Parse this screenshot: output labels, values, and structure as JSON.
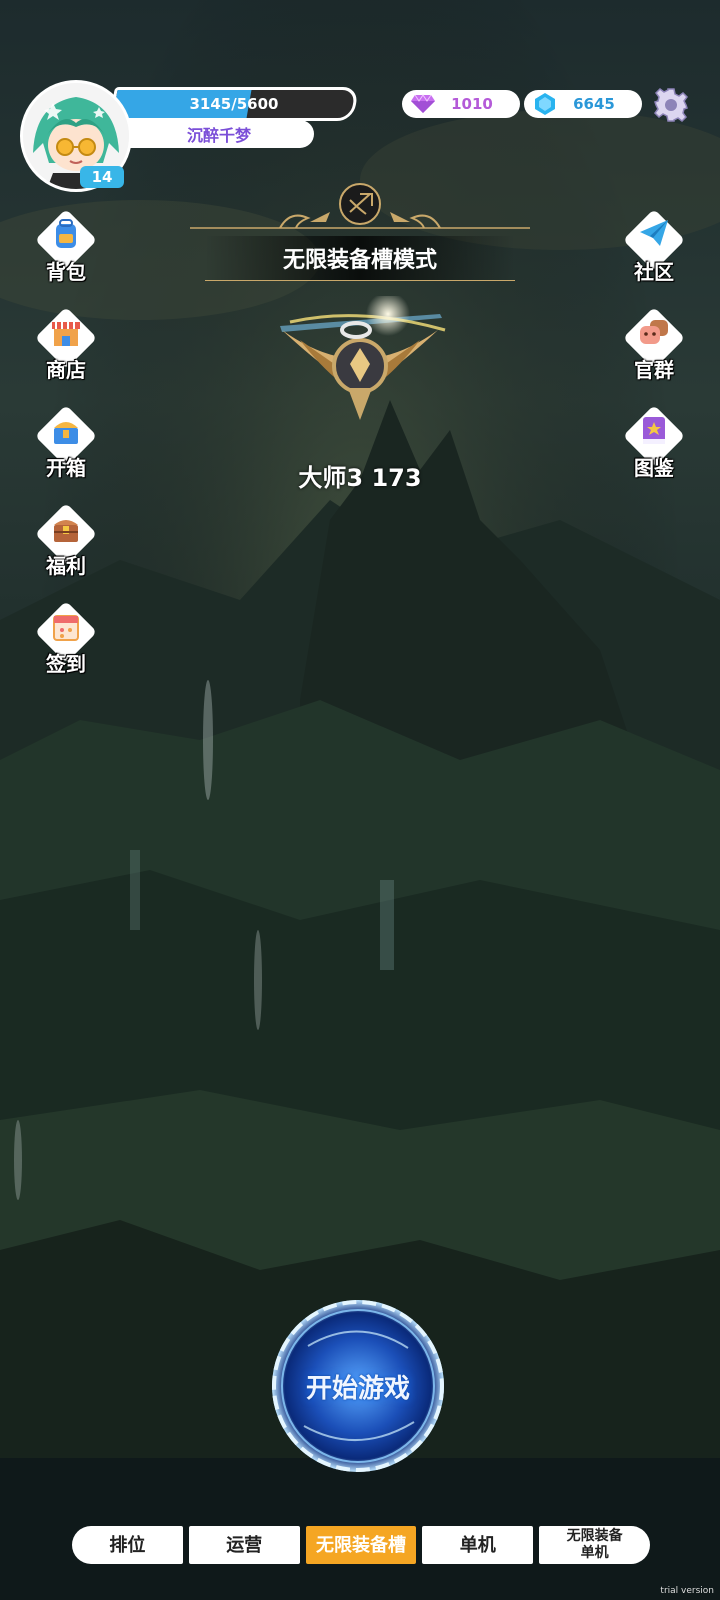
{
  "player": {
    "level": "14",
    "exp_text": "3145/5600",
    "exp_progress": 0.5616,
    "name": "沉醉千梦"
  },
  "currencies": {
    "gem": {
      "icon": "diamond-icon",
      "value": "1010"
    },
    "crystal": {
      "icon": "crystal-icon",
      "value": "6645"
    }
  },
  "left_menu": [
    {
      "icon": "backpack-icon",
      "label": "背包"
    },
    {
      "icon": "shop-icon",
      "label": "商店"
    },
    {
      "icon": "chest-icon",
      "label": "开箱"
    },
    {
      "icon": "gift-chest-icon",
      "label": "福利"
    },
    {
      "icon": "calendar-icon",
      "label": "签到"
    }
  ],
  "right_menu": [
    {
      "icon": "paper-plane-icon",
      "label": "社区"
    },
    {
      "icon": "group-chat-icon",
      "label": "官群"
    },
    {
      "icon": "book-icon",
      "label": "图鉴"
    }
  ],
  "mode": {
    "title": "无限装备槽模式"
  },
  "rank": {
    "text": "大师3 173"
  },
  "start_button": {
    "label": "开始游戏"
  },
  "tabs": [
    {
      "label": "排位",
      "active": false
    },
    {
      "label": "运营",
      "active": false
    },
    {
      "label": "无限装备槽",
      "active": true
    },
    {
      "label": "单机",
      "active": false
    },
    {
      "label": "无限装备\n单机",
      "active": false
    }
  ],
  "watermark": "trial version",
  "colors": {
    "active_tab": "#f5a623",
    "exp_fill": "#35a6e6",
    "name_text": "#7b4fd8"
  }
}
